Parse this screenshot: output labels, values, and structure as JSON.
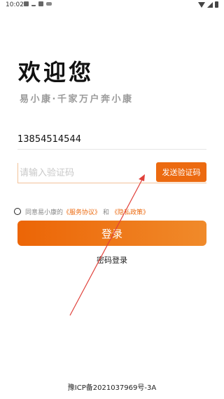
{
  "status_bar": {
    "time": "10:02",
    "left_icons": [
      "image-icon",
      "download-icon",
      "notification-icon",
      "cat-icon"
    ],
    "right_icons": [
      "wifi-icon",
      "signal-icon",
      "battery-icon"
    ]
  },
  "header": {
    "title": "欢迎您",
    "subtitle": "易小康·千家万户奔小康"
  },
  "form": {
    "phone_value": "13854514544",
    "code_placeholder": "请输入验证码",
    "send_code_label": "发送验证码"
  },
  "agreement": {
    "prefix": "同意易小康的",
    "terms_link": "《服务协议》",
    "conjunction": "和",
    "privacy_link": "《隐私政策》"
  },
  "actions": {
    "login_label": "登录",
    "password_login_label": "密码登录"
  },
  "footer": {
    "icp": "豫ICP备2021037969号-3A"
  },
  "colors": {
    "accent": "#ec6a10",
    "arrow": "#e0403a"
  }
}
